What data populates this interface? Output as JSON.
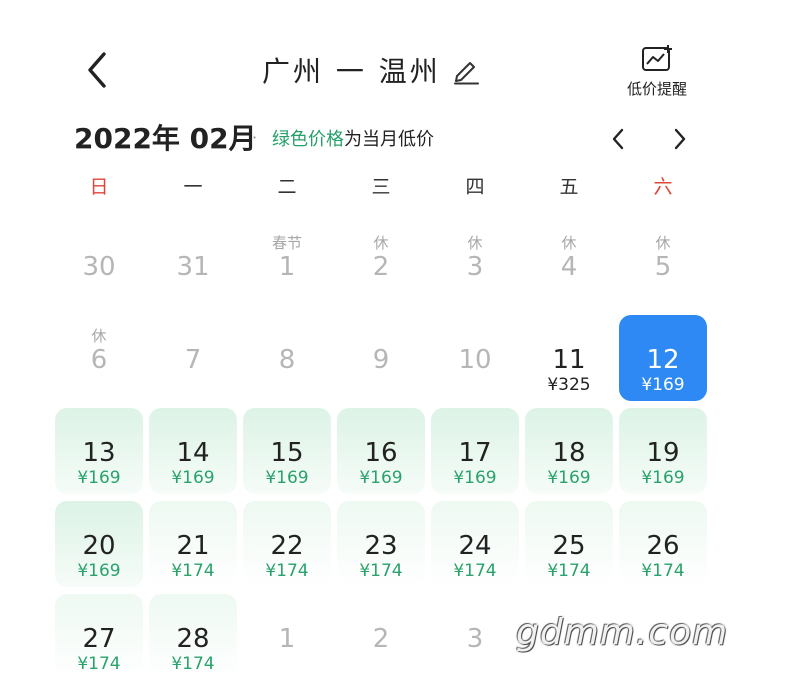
{
  "header": {
    "title": "广州 一 温州",
    "alert_label": "低价提醒"
  },
  "month": {
    "title": "2022年 02月",
    "dot": "·",
    "note_green": "绿色价格",
    "note_rest": "为当月低价"
  },
  "weekdays": [
    "日",
    "一",
    "二",
    "三",
    "四",
    "五",
    "六"
  ],
  "weeks": [
    [
      {
        "num": "30",
        "holiday": "",
        "price": "",
        "style": "dim"
      },
      {
        "num": "31",
        "holiday": "",
        "price": "",
        "style": "dim"
      },
      {
        "num": "1",
        "holiday": "春节",
        "price": "",
        "style": "dim"
      },
      {
        "num": "2",
        "holiday": "休",
        "price": "",
        "style": "dim"
      },
      {
        "num": "3",
        "holiday": "休",
        "price": "",
        "style": "dim"
      },
      {
        "num": "4",
        "holiday": "休",
        "price": "",
        "style": "dim"
      },
      {
        "num": "5",
        "holiday": "休",
        "price": "",
        "style": "dim"
      }
    ],
    [
      {
        "num": "6",
        "holiday": "休",
        "price": "",
        "style": "dim"
      },
      {
        "num": "7",
        "holiday": "",
        "price": "",
        "style": "dim"
      },
      {
        "num": "8",
        "holiday": "",
        "price": "",
        "style": "dim"
      },
      {
        "num": "9",
        "holiday": "",
        "price": "",
        "style": "dim"
      },
      {
        "num": "10",
        "holiday": "",
        "price": "",
        "style": "dim"
      },
      {
        "num": "11",
        "holiday": "",
        "price": "¥325",
        "style": "normal"
      },
      {
        "num": "12",
        "holiday": "",
        "price": "¥169",
        "style": "selected"
      }
    ],
    [
      {
        "num": "13",
        "holiday": "",
        "price": "¥169",
        "style": "green"
      },
      {
        "num": "14",
        "holiday": "",
        "price": "¥169",
        "style": "green"
      },
      {
        "num": "15",
        "holiday": "",
        "price": "¥169",
        "style": "green"
      },
      {
        "num": "16",
        "holiday": "",
        "price": "¥169",
        "style": "green"
      },
      {
        "num": "17",
        "holiday": "",
        "price": "¥169",
        "style": "green"
      },
      {
        "num": "18",
        "holiday": "",
        "price": "¥169",
        "style": "green"
      },
      {
        "num": "19",
        "holiday": "",
        "price": "¥169",
        "style": "green"
      }
    ],
    [
      {
        "num": "20",
        "holiday": "",
        "price": "¥169",
        "style": "green"
      },
      {
        "num": "21",
        "holiday": "",
        "price": "¥174",
        "style": "greenlight"
      },
      {
        "num": "22",
        "holiday": "",
        "price": "¥174",
        "style": "greenlight"
      },
      {
        "num": "23",
        "holiday": "",
        "price": "¥174",
        "style": "greenlight"
      },
      {
        "num": "24",
        "holiday": "",
        "price": "¥174",
        "style": "greenlight"
      },
      {
        "num": "25",
        "holiday": "",
        "price": "¥174",
        "style": "greenlight"
      },
      {
        "num": "26",
        "holiday": "",
        "price": "¥174",
        "style": "greenlight"
      }
    ],
    [
      {
        "num": "27",
        "holiday": "",
        "price": "¥174",
        "style": "greenlight"
      },
      {
        "num": "28",
        "holiday": "",
        "price": "¥174",
        "style": "greenlight"
      },
      {
        "num": "1",
        "holiday": "",
        "price": "",
        "style": "dim"
      },
      {
        "num": "2",
        "holiday": "",
        "price": "",
        "style": "dim"
      },
      {
        "num": "3",
        "holiday": "",
        "price": "",
        "style": "dim"
      },
      {
        "num": "",
        "holiday": "",
        "price": "",
        "style": "blank"
      },
      {
        "num": "",
        "holiday": "",
        "price": "",
        "style": "blank"
      }
    ]
  ],
  "watermark": "gdmm.com",
  "colors": {
    "accent_green": "#2aa26b",
    "selected_blue": "#2f89f4",
    "weekend_red": "#e0453a"
  },
  "icons": {
    "back": "chevron-left-icon",
    "edit": "pencil-icon",
    "alert": "price-chart-plus-icon",
    "prev": "chevron-left-icon",
    "next": "chevron-right-icon"
  }
}
